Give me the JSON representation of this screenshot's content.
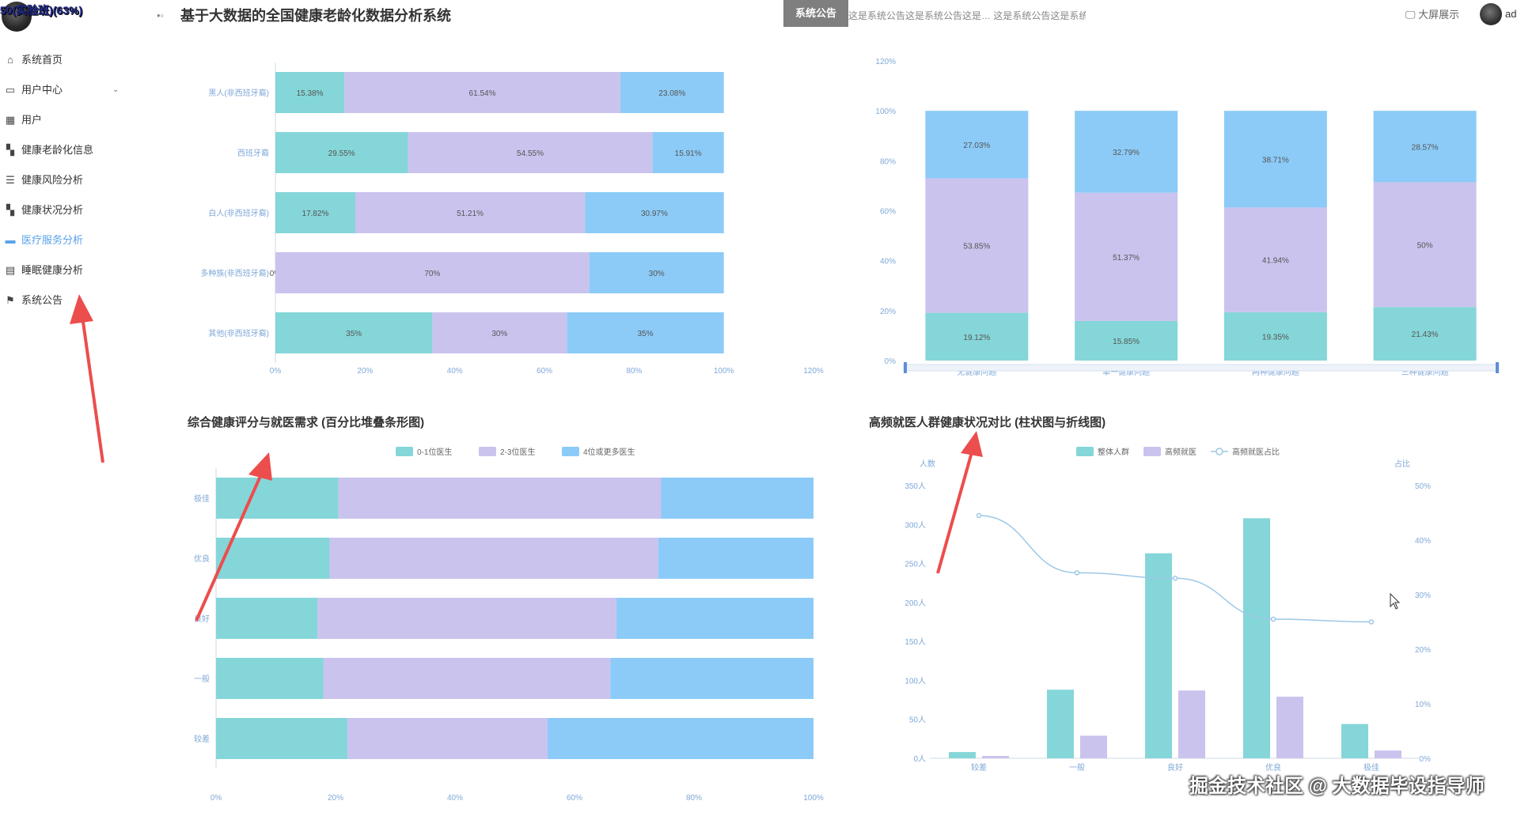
{
  "header": {
    "username": "50(实验班)(63%)",
    "title": "基于大数据的全国健康老龄化数据分析系统",
    "notice_label": "系统公告",
    "notice_text": "这是系统公告这是系统公告这是… 这是系统公告这是系统公告",
    "fullscreen_label": "大屏展示",
    "admin_label": "ad"
  },
  "sidebar": {
    "items": [
      {
        "label": "系统首页",
        "icon": "home-icon",
        "glyph": "⌂"
      },
      {
        "label": "用户中心",
        "icon": "folder-icon",
        "glyph": "▭",
        "chevron": "⌄"
      },
      {
        "label": "用户",
        "icon": "grid-icon",
        "glyph": "▦"
      },
      {
        "label": "健康老龄化信息",
        "icon": "apps-icon",
        "glyph": "▚"
      },
      {
        "label": "健康风险分析",
        "icon": "list-icon",
        "glyph": "☰"
      },
      {
        "label": "健康状况分析",
        "icon": "apps-icon",
        "glyph": "▚"
      },
      {
        "label": "医疗服务分析",
        "icon": "monitor-icon",
        "glyph": "▬"
      },
      {
        "label": "睡眠健康分析",
        "icon": "clipboard-icon",
        "glyph": "▤"
      },
      {
        "label": "系统公告",
        "icon": "flag-icon",
        "glyph": "⚑"
      }
    ],
    "active_index": 6
  },
  "colors": {
    "teal": "#85d6d8",
    "lavender": "#cac3ee",
    "blue": "#8ccbf7",
    "axis_text": "#7fa8d8",
    "line": "#9cc8e6",
    "arrow": "#ec4d4d"
  },
  "charts": {
    "race_chart": {
      "chart_data": {
        "type": "bar",
        "orientation": "horizontal-stacked-percent",
        "categories": [
          "黑人(非西班牙裔)",
          "西班牙裔",
          "白人(非西班牙裔)",
          "多种族(非西班牙裔)",
          "其他(非西班牙裔)"
        ],
        "series": [
          {
            "values": [
              15.38,
              29.55,
              17.82,
              0,
              35
            ],
            "labels": [
              "15.38%",
              "29.55%",
              "17.82%",
              "0%",
              "35%"
            ]
          },
          {
            "values": [
              61.54,
              54.55,
              51.21,
              70,
              30
            ],
            "labels": [
              "61.54%",
              "54.55%",
              "51.21%",
              "70%",
              "30%"
            ]
          },
          {
            "values": [
              23.08,
              15.91,
              30.97,
              30,
              35
            ],
            "labels": [
              "23.08%",
              "15.91%",
              "30.97%",
              "30%",
              "35%"
            ]
          }
        ],
        "xticks": [
          "0%",
          "20%",
          "40%",
          "60%",
          "80%",
          "100%",
          "120%"
        ],
        "xlim": [
          0,
          120
        ]
      }
    },
    "problems_chart": {
      "chart_data": {
        "type": "bar",
        "orientation": "vertical-stacked-percent",
        "categories": [
          "无健康问题",
          "单一健康问题",
          "两种健康问题",
          "三种健康问题"
        ],
        "series": [
          {
            "values": [
              19.12,
              15.85,
              19.35,
              21.43
            ],
            "labels": [
              "19.12%",
              "15.85%",
              "19.35%",
              "21.43%"
            ]
          },
          {
            "values": [
              53.85,
              51.37,
              41.94,
              50
            ],
            "labels": [
              "53.85%",
              "51.37%",
              "41.94%",
              "50%"
            ]
          },
          {
            "values": [
              27.03,
              32.79,
              38.71,
              28.57
            ],
            "labels": [
              "27.03%",
              "32.79%",
              "38.71%",
              "28.57%"
            ]
          }
        ],
        "yticks": [
          "0%",
          "20%",
          "40%",
          "60%",
          "80%",
          "100%",
          "120%"
        ],
        "ylim": [
          0,
          120
        ]
      }
    },
    "score_chart": {
      "title": "综合健康评分与就医需求 (百分比堆叠条形图)",
      "chart_data": {
        "type": "bar",
        "orientation": "horizontal-stacked-percent",
        "categories": [
          "极佳",
          "优良",
          "良好",
          "一般",
          "较差"
        ],
        "series": [
          {
            "name": "0-1位医生",
            "values": [
              20.5,
              19,
              17,
              18,
              22
            ]
          },
          {
            "name": "2-3位医生",
            "values": [
              54,
              55,
              50,
              48,
              33.5
            ]
          },
          {
            "name": "4位或更多医生",
            "values": [
              25.5,
              26,
              33,
              34,
              44.5
            ]
          }
        ],
        "xticks": [
          "0%",
          "20%",
          "40%",
          "60%",
          "80%",
          "100%"
        ],
        "xlim": [
          0,
          100
        ],
        "legend_position": "top"
      }
    },
    "frequency_chart": {
      "title": "高频就医人群健康状况对比 (柱状图与折线图)",
      "chart_data": {
        "type": "bar",
        "combo": "bar+line",
        "categories": [
          "较差",
          "一般",
          "良好",
          "优良",
          "极佳"
        ],
        "series": [
          {
            "name": "整体人群",
            "type": "bar",
            "values": [
              8,
              88,
              263,
              308,
              44
            ]
          },
          {
            "name": "高频就医",
            "type": "bar",
            "values": [
              3,
              29,
              87,
              79,
              10
            ]
          },
          {
            "name": "高频就医占比",
            "type": "line",
            "axis": "right",
            "values": [
              44.5,
              34,
              33,
              25.5,
              25
            ]
          }
        ],
        "ylabel_left": "人数",
        "ylabel_right": "占比",
        "yticks_left": [
          "0人",
          "50人",
          "100人",
          "150人",
          "200人",
          "250人",
          "300人",
          "350人"
        ],
        "ylim_left": [
          0,
          350
        ],
        "yticks_right": [
          "0%",
          "10%",
          "20%",
          "30%",
          "40%",
          "50%"
        ],
        "ylim_right": [
          0,
          50
        ],
        "legend_position": "top"
      }
    }
  },
  "watermark": "掘金技术社区 @ 大数据毕设指导师"
}
